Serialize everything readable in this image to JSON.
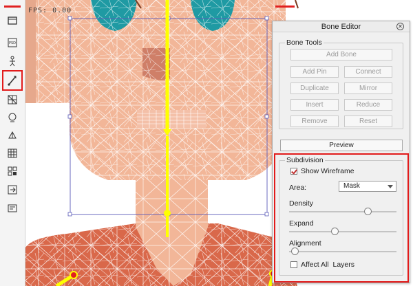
{
  "toolbar": {
    "tools": [
      {
        "name": "layer-tool-icon",
        "active": false
      },
      {
        "name": "psd-tool-icon",
        "active": false
      },
      {
        "name": "skeleton-tool-icon",
        "active": false
      },
      {
        "name": "bone-tool-icon",
        "active": true
      },
      {
        "name": "deform-tool-icon",
        "active": false
      },
      {
        "name": "head-tool-icon",
        "active": false
      },
      {
        "name": "transform-tool-icon",
        "active": false
      },
      {
        "name": "grid-tool-icon",
        "active": false
      },
      {
        "name": "mesh-tool-icon",
        "active": false
      },
      {
        "name": "export-tool-icon",
        "active": false
      },
      {
        "name": "settings-tool-icon",
        "active": false
      }
    ]
  },
  "canvas": {
    "readout": "FPS: 0.00"
  },
  "bone_editor": {
    "title": "Bone Editor",
    "bone_tools": {
      "label": "Bone Tools",
      "add_bone": "Add Bone",
      "add_pin": "Add Pin",
      "connect": "Connect",
      "duplicate": "Duplicate",
      "mirror": "Mirror",
      "insert": "Insert",
      "reduce": "Reduce",
      "remove": "Remove",
      "reset": "Reset"
    },
    "preview": "Preview",
    "subdivision": {
      "label": "Subdivision",
      "show_wireframe": "Show Wireframe",
      "show_wireframe_checked": true,
      "area_label": "Area:",
      "area_value": "Mask",
      "density_label": "Density",
      "density_value": 0.73,
      "expand_label": "Expand",
      "expand_value": 0.42,
      "alignment_label": "Alignment",
      "alignment_value": 0.05,
      "affect_all_layers": "Affect All  Layers",
      "affect_all_layers_checked": false
    }
  },
  "colors": {
    "skin": "#f2b698",
    "skin_shadow": "#cf7f68",
    "shirt": "#d9684a",
    "eye": "#1f9aa3",
    "bone": "#ffff00",
    "highlight": "#e21b1b"
  }
}
